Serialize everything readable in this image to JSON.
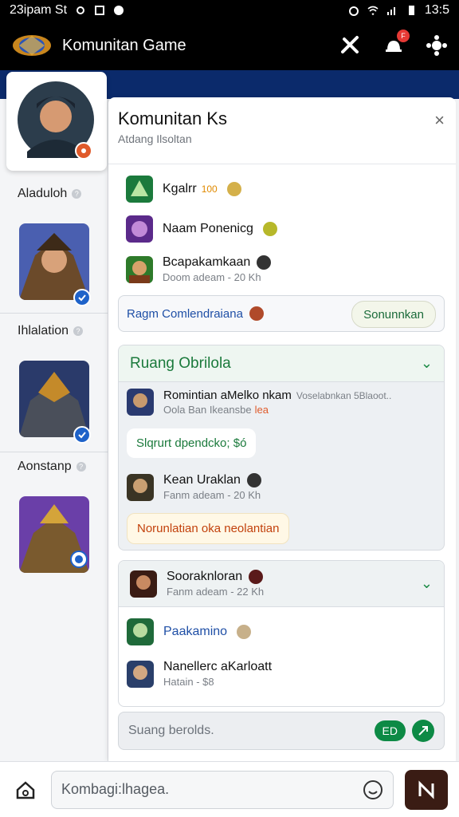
{
  "status_bar": {
    "left_text": "23ipam St",
    "time": "13:5"
  },
  "app_bar": {
    "title": "Komunitan Game"
  },
  "panel": {
    "title": "Komunitan Ks",
    "subtitle": "Atdang Ilsoltan",
    "close_glyph": "×"
  },
  "rail": {
    "sections": [
      {
        "label": "Aladuloh"
      },
      {
        "label": "Ihlalation"
      },
      {
        "label": "Aonstanp"
      }
    ]
  },
  "list_top": [
    {
      "name": "Kgalrr",
      "tag": "100",
      "meta": ""
    },
    {
      "name": "Naam Ponenicg",
      "tag": "",
      "meta": ""
    },
    {
      "name": "Bcapakamkaan",
      "tag": "",
      "meta": "Doom adeam - 20 Kh"
    }
  ],
  "promo": {
    "text": "Ragm Comlendraiana",
    "button": "Sonunnkan"
  },
  "group1": {
    "title": "Ruang Obrilola",
    "chevron": "⌄",
    "items": [
      {
        "name": "Romintian aMelko nkam",
        "meta": "Oola Ban Ikeansbe",
        "tag": "lea",
        "side": "Voselabnkan 5Blaoot.."
      },
      {
        "bubble": "Slqrurt dpendcko; $ó"
      },
      {
        "name": "Kean Uraklan",
        "meta": "Fanm adeam - 20 Kh"
      },
      {
        "bubble": "Norunlatian oka neolantian"
      }
    ]
  },
  "group2": {
    "title": "Sooraknloran",
    "meta": "Fanm adeam - 22 Kh",
    "chevron": "⌄",
    "items": [
      {
        "name": "Paakamino",
        "meta": ""
      },
      {
        "name": "Nanellerc aKarloatt",
        "meta": "Hatain - $8"
      }
    ]
  },
  "composer": {
    "placeholder": "Suang berolds.",
    "chip": "ED"
  },
  "bottom": {
    "placeholder": "Kombagi:lhagea."
  },
  "colors": {
    "accent_green": "#0d8a45",
    "title_green": "#1b7a3c",
    "navy": "#0b2a6b"
  }
}
